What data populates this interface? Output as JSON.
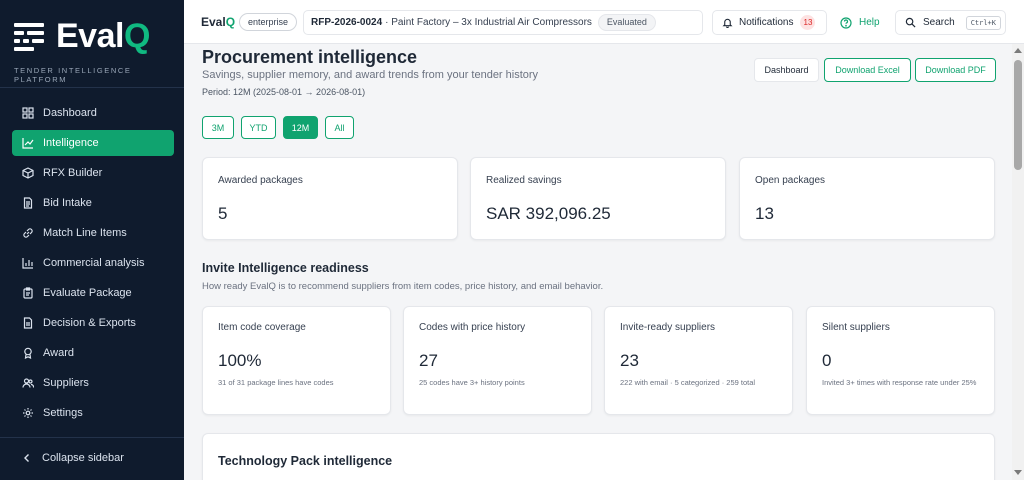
{
  "colors": {
    "accent": "#10a36f",
    "sidebar_bg": "#0f1b2d",
    "notif_badge": "#dc2626"
  },
  "sidebar": {
    "logo": {
      "text_main": "EvalQ",
      "text_prefix": "Eval",
      "text_suffix": "Q"
    },
    "tagline": "TENDER INTELLIGENCE PLATFORM",
    "items": [
      {
        "label": "Dashboard",
        "icon": "grid-icon"
      },
      {
        "label": "Intelligence",
        "icon": "chart-line-icon",
        "active": true
      },
      {
        "label": "RFX Builder",
        "icon": "cube-icon"
      },
      {
        "label": "Bid Intake",
        "icon": "document-icon"
      },
      {
        "label": "Match Line Items",
        "icon": "link-icon"
      },
      {
        "label": "Commercial analysis",
        "icon": "bar-chart-icon"
      },
      {
        "label": "Evaluate Package",
        "icon": "clipboard-icon"
      },
      {
        "label": "Decision & Exports",
        "icon": "file-export-icon"
      },
      {
        "label": "Award",
        "icon": "medal-icon"
      },
      {
        "label": "Suppliers",
        "icon": "users-icon"
      },
      {
        "label": "Settings",
        "icon": "gear-icon"
      }
    ],
    "collapse_label": "Collapse sidebar"
  },
  "topbar": {
    "brand_prefix": "Eval",
    "brand_suffix": "Q",
    "env_badge": "enterprise",
    "rfp_code": "RFP-2026-0024",
    "rfp_title": "· Paint Factory – 3x Industrial Air Compressors",
    "rfp_status": "Evaluated",
    "notifications_label": "Notifications",
    "notifications_count": "13",
    "help_label": "Help",
    "search_label": "Search",
    "search_shortcut": "Ctrl+K"
  },
  "page": {
    "title": "Procurement intelligence",
    "subtitle": "Savings, supplier memory, and award trends from your tender history",
    "period": "Period: 12M (2025-08-01 → 2026-08-01)",
    "actions": {
      "dashboard": "Dashboard",
      "excel": "Download Excel",
      "pdf": "Download PDF"
    },
    "ranges": [
      {
        "label": "3M"
      },
      {
        "label": "YTD"
      },
      {
        "label": "12M",
        "active": true
      },
      {
        "label": "All"
      }
    ],
    "kpis": [
      {
        "label": "Awarded packages",
        "value": "5"
      },
      {
        "label": "Realized savings",
        "value": "SAR 392,096.25"
      },
      {
        "label": "Open packages",
        "value": "13"
      }
    ],
    "readiness": {
      "title": "Invite Intelligence readiness",
      "subtitle": "How ready EvalQ is to recommend suppliers from item codes, price history, and email behavior.",
      "cards": [
        {
          "label": "Item code coverage",
          "value": "100%",
          "note": "31 of 31 package lines have codes"
        },
        {
          "label": "Codes with price history",
          "value": "27",
          "note": "25 codes have 3+ history points"
        },
        {
          "label": "Invite-ready suppliers",
          "value": "23",
          "note": "222 with email · 5 categorized · 259 total"
        },
        {
          "label": "Silent suppliers",
          "value": "0",
          "note": "Invited 3+ times with response rate under 25%"
        }
      ]
    },
    "tech_pack_title": "Technology Pack intelligence"
  }
}
